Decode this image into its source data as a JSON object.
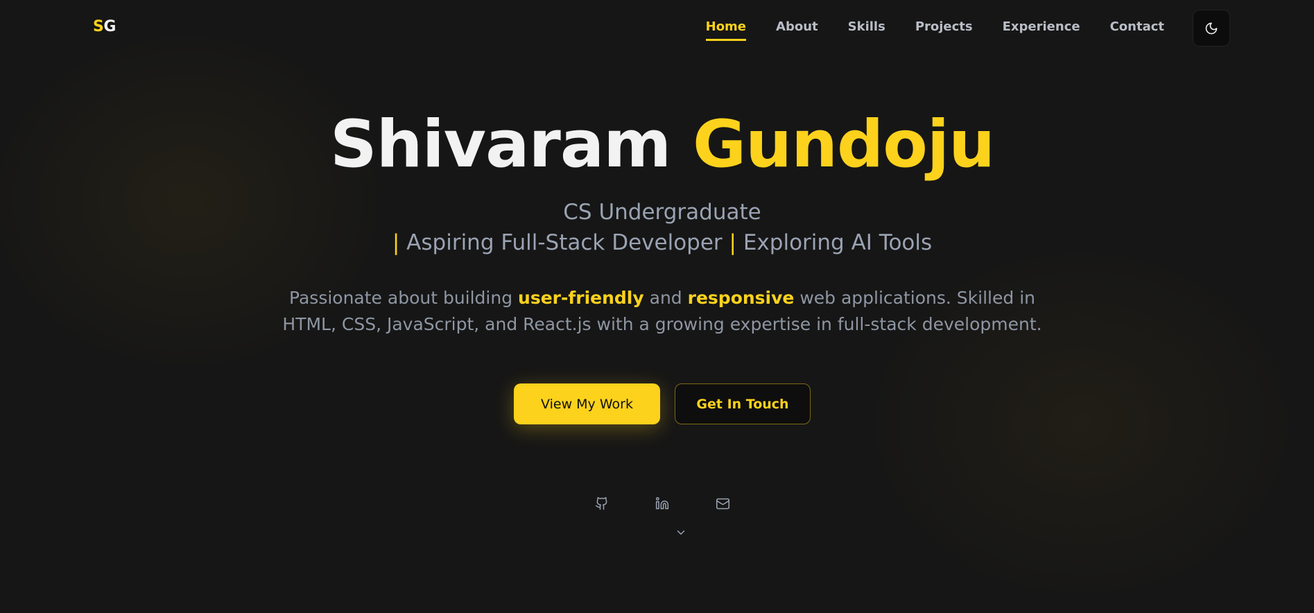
{
  "logo": {
    "first": "S",
    "second": "G"
  },
  "nav": {
    "items": [
      {
        "label": "Home",
        "active": true
      },
      {
        "label": "About"
      },
      {
        "label": "Skills"
      },
      {
        "label": "Projects"
      },
      {
        "label": "Experience"
      },
      {
        "label": "Contact"
      }
    ],
    "theme_toggle_icon": "moon-icon"
  },
  "hero": {
    "first_name": "Shivaram",
    "last_name": "Gundoju",
    "subtitle_line1": "CS Undergraduate",
    "separator": "|",
    "role1": "Aspiring Full-Stack Developer",
    "role2": "Exploring AI Tools",
    "desc_part1": "Passionate about building",
    "desc_hl1": "user-friendly",
    "desc_part2": "and",
    "desc_hl2": "responsive",
    "desc_part3": "web applications. Skilled in",
    "desc_line2": "HTML, CSS, JavaScript, and React.js with a growing expertise in full-stack development.",
    "primary_button": "View My Work",
    "secondary_button": "Get In Touch"
  },
  "social": {
    "icons": [
      "github-icon",
      "linkedin-icon",
      "mail-icon"
    ]
  },
  "colors": {
    "accent": "#fcd21c",
    "background": "#161616",
    "text_muted": "#9aa3b2"
  }
}
